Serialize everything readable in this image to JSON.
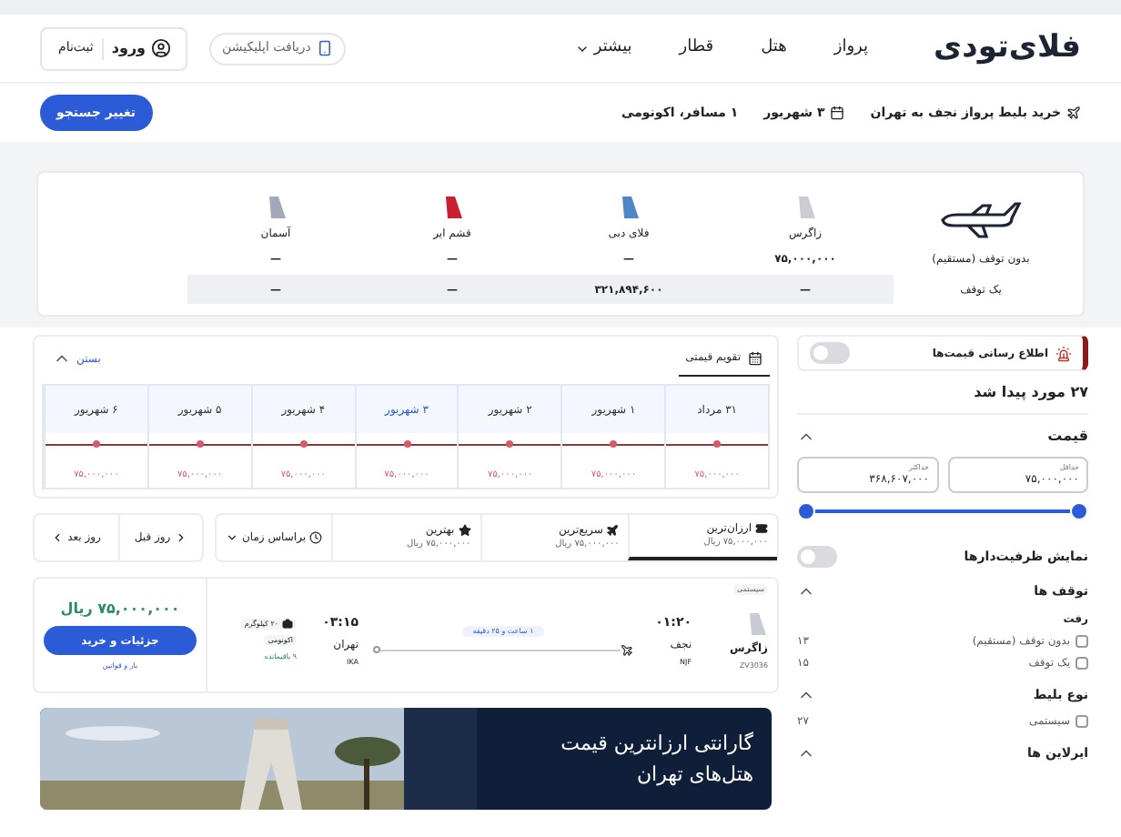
{
  "header": {
    "logo": "فلای‌تودی",
    "nav": [
      {
        "label": "پرواز",
        "dropdown": false
      },
      {
        "label": "هتل",
        "dropdown": false
      },
      {
        "label": "قطار",
        "dropdown": false
      },
      {
        "label": "بیشتر",
        "dropdown": true
      }
    ],
    "app_button": "دریافت اپلیکیشن",
    "login": "ورود",
    "signup": "ثبت‌نام"
  },
  "search_summary": {
    "route": "خرید بلیط پرواز نجف به تهران",
    "date": "۳ شهریور",
    "passengers": "۱ مسافر، اکونومی",
    "change_button": "تغییر جستجو"
  },
  "airline_table": {
    "airlines": [
      {
        "name": "زاگرس",
        "color": "#c9ccd3"
      },
      {
        "name": "فلای دبی",
        "color": "#4f86c6"
      },
      {
        "name": "قشم ایر",
        "color": "#c8202f"
      },
      {
        "name": "آسمان",
        "color": "#a3a9b8"
      }
    ],
    "rows": [
      {
        "label": "بدون توقف (مستقیم)",
        "cells": [
          "۷۵,۰۰۰,۰۰۰",
          "—",
          "—",
          "—"
        ],
        "highlighted": false
      },
      {
        "label": "یک توقف",
        "cells": [
          "—",
          "۳۲۱,۸۹۴,۶۰۰",
          "—",
          "—"
        ],
        "highlighted": true
      }
    ]
  },
  "sidebar": {
    "price_alert": {
      "label": "اطلاع رسانی قیمت‌ها",
      "on": false
    },
    "result_count": "۲۷ مورد پیدا شد",
    "price_filter": {
      "title": "قیمت",
      "expanded": true,
      "min": {
        "label": "حداقل",
        "value": "۷۵,۰۰۰,۰۰۰"
      },
      "max": {
        "label": "حداکثر",
        "value": "۳۶۸,۶۰۷,۰۰۰"
      }
    },
    "capacity_toggle": {
      "label": "نمایش ظرفیت‌دارها",
      "on": false
    },
    "filters": [
      {
        "title": "توقف ها",
        "expanded": true,
        "groups": [
          {
            "title": "رفت",
            "options": [
              {
                "label": "بدون توقف (مستقیم)",
                "count": "۱۳",
                "checked": false
              },
              {
                "label": "یک توقف",
                "count": "۱۵",
                "checked": false
              }
            ]
          }
        ]
      },
      {
        "title": "نوع بلیط",
        "expanded": true,
        "groups": [
          {
            "options": [
              {
                "label": "سیستمی",
                "count": "۲۷",
                "checked": false
              }
            ]
          }
        ]
      },
      {
        "title": "ایرلاین ها",
        "expanded": true
      }
    ]
  },
  "calendar": {
    "tab": "تقویم قیمتی",
    "close": "بستن",
    "expanded": true,
    "days": [
      {
        "date": "۳۱ مرداد",
        "price": "۷۵,۰۰۰,۰۰۰",
        "selected": false
      },
      {
        "date": "۱ شهریور",
        "price": "۷۵,۰۰۰,۰۰۰",
        "selected": false
      },
      {
        "date": "۲ شهریور",
        "price": "۷۵,۰۰۰,۰۰۰",
        "selected": false
      },
      {
        "date": "۳ شهریور",
        "price": "۷۵,۰۰۰,۰۰۰",
        "selected": true
      },
      {
        "date": "۴ شهریور",
        "price": "۷۵,۰۰۰,۰۰۰",
        "selected": false
      },
      {
        "date": "۵ شهریور",
        "price": "۷۵,۰۰۰,۰۰۰",
        "selected": false
      },
      {
        "date": "۶ شهریور",
        "price": "۷۵,۰۰۰,۰۰۰",
        "selected": false
      }
    ]
  },
  "sort": {
    "options": [
      {
        "kind": "cheapest",
        "label": "ارزان‌ترین",
        "price": "۷۵,۰۰۰,۰۰۰ ریال",
        "selected": true
      },
      {
        "kind": "fastest",
        "label": "سریع‌ترین",
        "price": "۷۵,۰۰۰,۰۰۰ ریال",
        "selected": false
      },
      {
        "kind": "best",
        "label": "بهترین",
        "price": "۷۵,۰۰۰,۰۰۰ ریال",
        "selected": false
      }
    ],
    "order": "براساس زمان",
    "prev_day": "روز قبل",
    "next_day": "روز بعد"
  },
  "flight": {
    "badge": "سیستمی",
    "airline": "زاگرس",
    "flight_no": "ZV3036",
    "departure": {
      "time": "۰۱:۲۰",
      "city": "نجف",
      "code": "NJF"
    },
    "duration": "۱ ساعت و ۲۵ دقیقه",
    "arrival": {
      "time": "۰۳:۱۵",
      "city": "تهران",
      "code": "IKA"
    },
    "baggage": "۲۰ کیلوگرم",
    "cabin": "اکونومی",
    "seats": "۹ باقیمانده",
    "price": "۷۵,۰۰۰,۰۰۰ ریال",
    "buy_button": "جزئیات و خرید",
    "rules_link": "بار و قوانین"
  },
  "banner": {
    "lines": [
      "گارانتی ارزانترین قیمت",
      "هتل‌های تهران"
    ]
  }
}
